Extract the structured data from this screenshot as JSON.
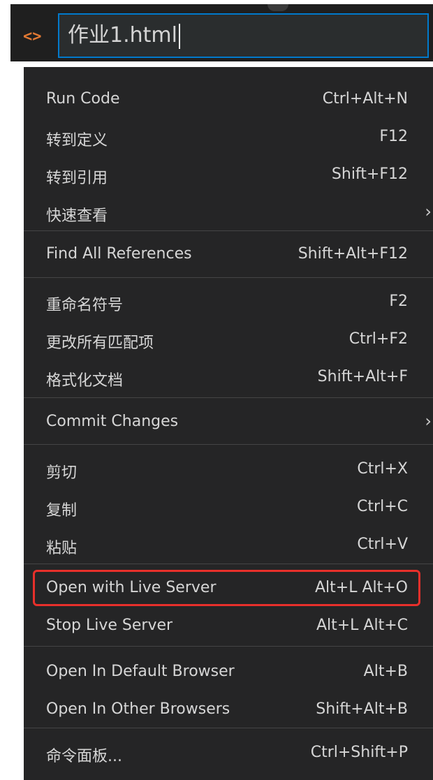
{
  "filename": {
    "icon": "code-bracket-icon",
    "value": "作业1.html",
    "icon_color": "#e37933"
  },
  "menu": {
    "groups": [
      {
        "items": [
          {
            "label": "Run Code",
            "shortcut": "Ctrl+Alt+N"
          },
          {
            "label": "转到定义",
            "shortcut": "F12"
          },
          {
            "label": "转到引用",
            "shortcut": "Shift+F12"
          },
          {
            "label": "快速查看",
            "shortcut": "",
            "submenu": true
          }
        ]
      },
      {
        "items": [
          {
            "label": "Find All References",
            "shortcut": "Shift+Alt+F12"
          }
        ]
      },
      {
        "items": [
          {
            "label": "重命名符号",
            "shortcut": "F2"
          },
          {
            "label": "更改所有匹配项",
            "shortcut": "Ctrl+F2"
          },
          {
            "label": "格式化文档",
            "shortcut": "Shift+Alt+F"
          }
        ]
      },
      {
        "items": [
          {
            "label": "Commit Changes",
            "shortcut": "",
            "submenu": true
          }
        ]
      },
      {
        "items": [
          {
            "label": "剪切",
            "shortcut": "Ctrl+X"
          },
          {
            "label": "复制",
            "shortcut": "Ctrl+C"
          },
          {
            "label": "粘贴",
            "shortcut": "Ctrl+V"
          }
        ]
      },
      {
        "items": [
          {
            "label": "Open with Live Server",
            "shortcut": "Alt+L Alt+O",
            "highlighted": true
          },
          {
            "label": "Stop Live Server",
            "shortcut": "Alt+L Alt+C"
          }
        ]
      },
      {
        "items": [
          {
            "label": "Open In Default Browser",
            "shortcut": "Alt+B"
          },
          {
            "label": "Open In Other Browsers",
            "shortcut": "Shift+Alt+B"
          }
        ]
      },
      {
        "items": [
          {
            "label": "命令面板...",
            "shortcut": "Ctrl+Shift+P"
          }
        ]
      }
    ],
    "highlight_color": "#e8302b"
  }
}
